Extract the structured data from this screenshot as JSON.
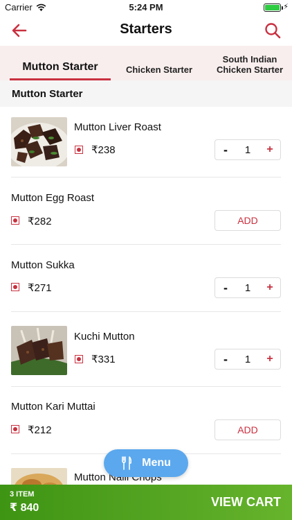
{
  "status_bar": {
    "carrier": "Carrier",
    "time": "5:24 PM",
    "battery_level": 1.0
  },
  "header": {
    "title": "Starters",
    "back_icon": "arrow-left-icon",
    "search_icon": "search-icon"
  },
  "tabs": [
    {
      "label": "Mutton Starter",
      "active": true
    },
    {
      "label": "Chicken Starter",
      "active": false
    },
    {
      "label_line1": "South Indian",
      "label_line2": "Chicken Starter",
      "active": false
    }
  ],
  "section": {
    "title": "Mutton Starter"
  },
  "items": [
    {
      "name": "Mutton Liver Roast",
      "price": "₹238",
      "has_image": true,
      "in_cart": true,
      "qty": "1"
    },
    {
      "name": "Mutton Egg Roast",
      "price": "₹282",
      "has_image": false,
      "in_cart": false,
      "add_label": "ADD"
    },
    {
      "name": "Mutton Sukka",
      "price": "₹271",
      "has_image": false,
      "in_cart": true,
      "qty": "1"
    },
    {
      "name": "Kuchi Mutton",
      "price": "₹331",
      "has_image": true,
      "in_cart": true,
      "qty": "1"
    },
    {
      "name": "Mutton Kari Muttai",
      "price": "₹212",
      "has_image": false,
      "in_cart": false,
      "add_label": "ADD"
    },
    {
      "name": "Mutton Nalli Chops",
      "has_image": true
    }
  ],
  "stepper": {
    "minus": "-",
    "plus": "+"
  },
  "menu_button": {
    "label": "Menu",
    "icon": "fork-knife-icon"
  },
  "cart": {
    "item_count": "3 ITEM",
    "total": "₹ 840",
    "action": "VIEW CART"
  },
  "colors": {
    "accent": "#c9303f",
    "tab_bg": "#f9eeee",
    "cart_green": "#56a623",
    "menu_blue": "#5ba8ee"
  }
}
